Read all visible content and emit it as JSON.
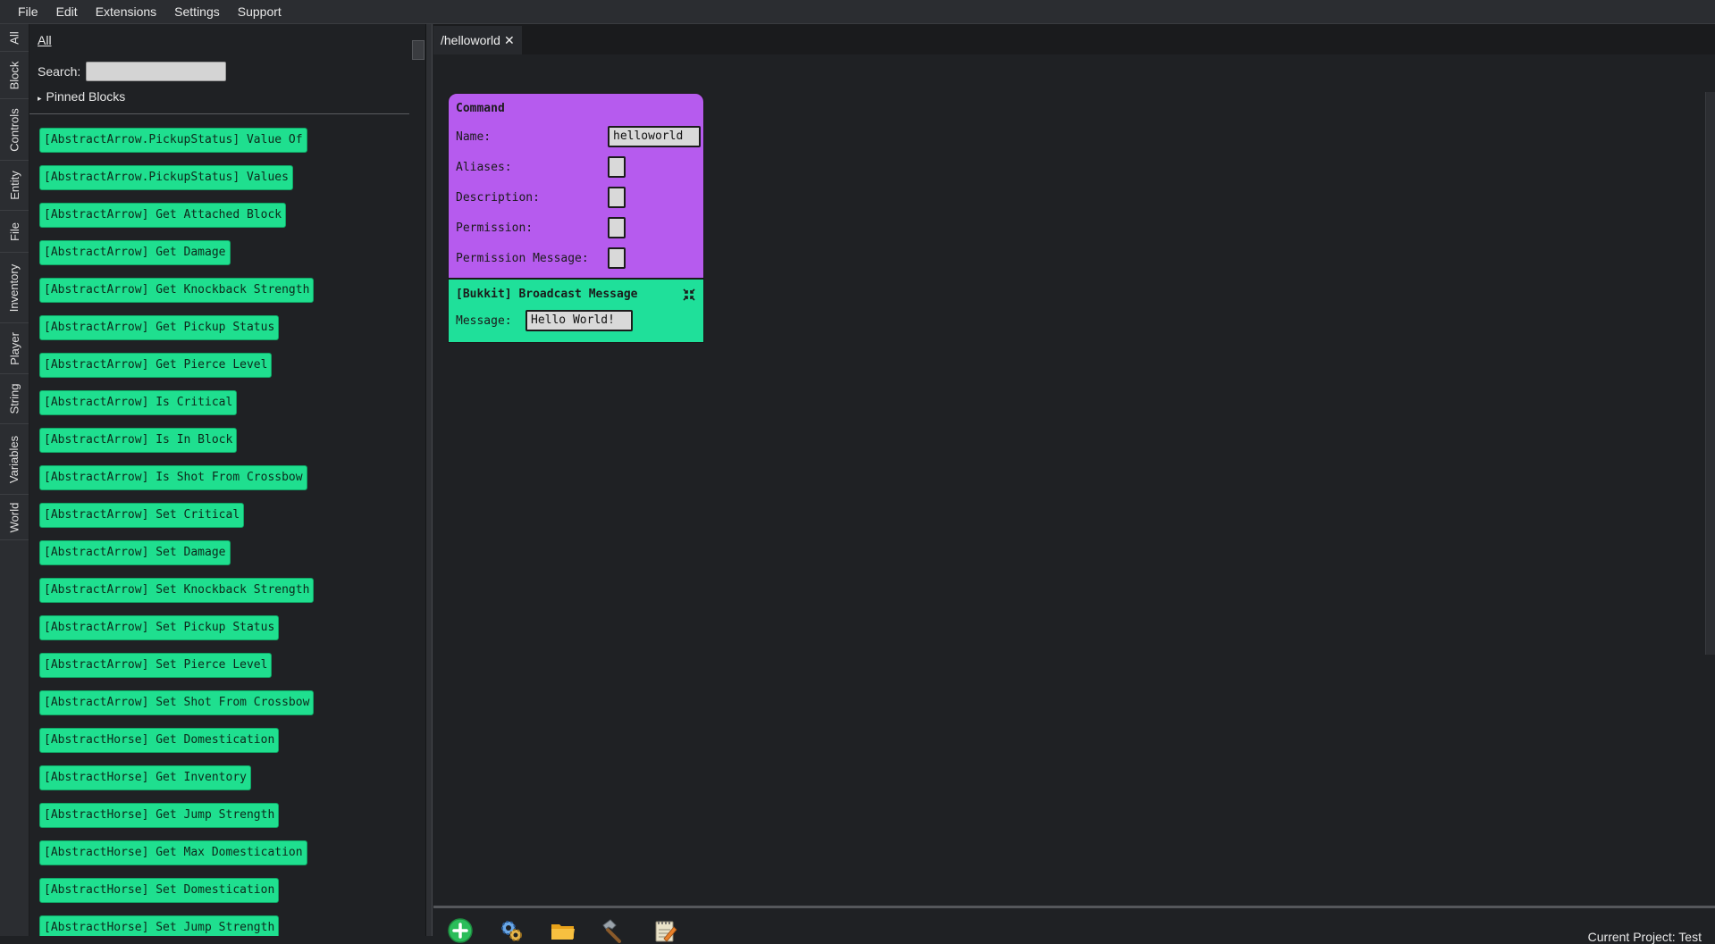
{
  "menu": [
    "File",
    "Edit",
    "Extensions",
    "Settings",
    "Support"
  ],
  "categories": [
    "All",
    "Block",
    "Controls",
    "Entity",
    "File",
    "Inventory",
    "Player",
    "String",
    "Variables",
    "World"
  ],
  "panel": {
    "all_label": "All",
    "search_label": "Search:",
    "search_value": "",
    "pinned_label": "Pinned Blocks"
  },
  "blocks": [
    "[AbstractArrow.PickupStatus] Value Of",
    "[AbstractArrow.PickupStatus] Values",
    "[AbstractArrow] Get Attached Block",
    "[AbstractArrow] Get Damage",
    "[AbstractArrow] Get Knockback Strength",
    "[AbstractArrow] Get Pickup Status",
    "[AbstractArrow] Get Pierce Level",
    "[AbstractArrow] Is Critical",
    "[AbstractArrow] Is In Block",
    "[AbstractArrow] Is Shot From Crossbow",
    "[AbstractArrow] Set Critical",
    "[AbstractArrow] Set Damage",
    "[AbstractArrow] Set Knockback Strength",
    "[AbstractArrow] Set Pickup Status",
    "[AbstractArrow] Set Pierce Level",
    "[AbstractArrow] Set Shot From Crossbow",
    "[AbstractHorse] Get Domestication",
    "[AbstractHorse] Get Inventory",
    "[AbstractHorse] Get Jump Strength",
    "[AbstractHorse] Get Max Domestication",
    "[AbstractHorse] Set Domestication",
    "[AbstractHorse] Set Jump Strength"
  ],
  "editor": {
    "tab_title": "/helloworld",
    "tab_close": "✕",
    "command_block": {
      "title": "Command",
      "fields": [
        {
          "label": "Name:",
          "value": "helloworld"
        },
        {
          "label": "Aliases:",
          "value": ""
        },
        {
          "label": "Description:",
          "value": ""
        },
        {
          "label": "Permission:",
          "value": ""
        },
        {
          "label": "Permission Message:",
          "value": ""
        }
      ]
    },
    "broadcast_block": {
      "title": "[Bukkit] Broadcast Message",
      "field_label": "Message:",
      "field_value": "Hello World!"
    }
  },
  "toolbar_icons": [
    "add-icon",
    "gears-icon",
    "folder-icon",
    "hammer-icon",
    "notepad-icon"
  ],
  "status": "Current Project: Test",
  "colors": {
    "command_block": "#b65bee",
    "action_block": "#1fe09a",
    "background": "#1f2124"
  }
}
